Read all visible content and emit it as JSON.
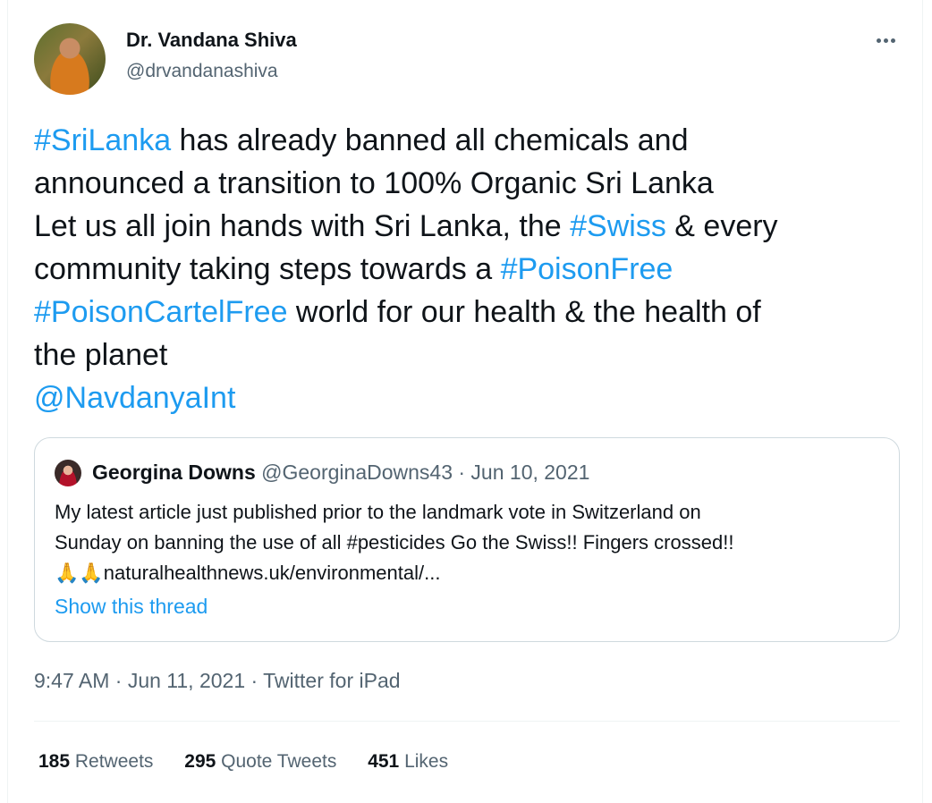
{
  "author": {
    "name": "Dr. Vandana Shiva",
    "handle": "@drvandanashiva"
  },
  "tweet": {
    "lines": [
      [
        {
          "text": "#SriLanka",
          "link": true
        },
        {
          "text": " has already banned all chemicals and",
          "link": false
        }
      ],
      [
        {
          "text": "announced a transition to 100% Organic Sri Lanka",
          "link": false
        }
      ],
      [
        {
          "text": "Let us all join hands with Sri Lanka, the ",
          "link": false
        },
        {
          "text": "#Swiss",
          "link": true
        },
        {
          "text": " & every",
          "link": false
        }
      ],
      [
        {
          "text": "community taking steps towards a ",
          "link": false
        },
        {
          "text": "#PoisonFree",
          "link": true
        }
      ],
      [
        {
          "text": "#PoisonCartelFree",
          "link": true
        },
        {
          "text": " world for our health & the health of",
          "link": false
        }
      ],
      [
        {
          "text": "the planet",
          "link": false
        }
      ],
      [
        {
          "text": "@NavdanyaInt",
          "link": true
        }
      ]
    ],
    "timestamp": "9:47 AM · Jun 11, 2021 · Twitter for iPad"
  },
  "quoted": {
    "name": "Georgina Downs",
    "handle_date": " @GeorginaDowns43 · Jun 10, 2021",
    "line1": "My latest article just published prior to the landmark vote in Switzerland on",
    "line2": "Sunday on banning the use of all #pesticides Go the Swiss!! Fingers crossed!!",
    "emoji": "🙏🙏",
    "link": "naturalhealthnews.uk/environmental/...",
    "show_thread": "Show this thread"
  },
  "stats": {
    "retweets_count": "185",
    "retweets_label": " Retweets",
    "quotes_count": "295",
    "quotes_label": " Quote Tweets",
    "likes_count": "451",
    "likes_label": " Likes"
  },
  "colors": {
    "link": "#1d9bf0",
    "text": "#0f1419",
    "muted": "#536471"
  },
  "icons": [
    "more-options-icon"
  ]
}
